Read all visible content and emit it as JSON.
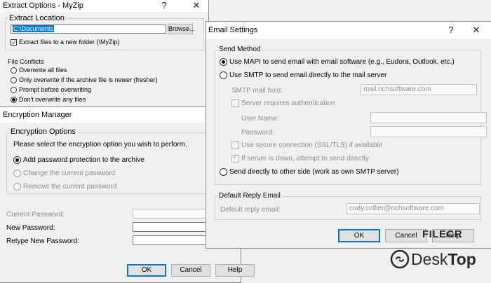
{
  "extract_window": {
    "title": "Extract Options - MyZip",
    "help_glyph": "?",
    "close_glyph": "✕",
    "extract_location": {
      "group_label": "Extract Location",
      "path_value": "C:\\Documents",
      "browse_label": "Browse...",
      "new_folder_label": "Extract files to a new folder (\\MyZip)",
      "new_folder_checked": true
    },
    "file_conflicts": {
      "group_label": "File Conflicts",
      "options": [
        "Overwrite all files",
        "Only overwrite if the archive file is newer (fresher)",
        "Prompt before overwriting",
        "Don't overwrite any files"
      ],
      "selected_index": 3
    }
  },
  "encryption_window": {
    "title": "Encryption Manager",
    "group_label": "Encryption Options",
    "instruction": "Please select the encryption option you wish to perform.",
    "options": [
      "Add password protection to the archive",
      "Change the current password",
      "Remove the current password"
    ],
    "selected_index": 0,
    "current_password_label": "Current Password:",
    "new_password_label": "New Password:",
    "retype_password_label": "Retype New Password:",
    "ok_label": "OK",
    "cancel_label": "Cancel",
    "help_label": "Help"
  },
  "email_window": {
    "title": "Email Settings",
    "help_glyph": "?",
    "close_glyph": "✕",
    "send_method": {
      "group_label": "Send Method",
      "mapi_label": "Use MAPI to send email with email software (e.g., Eudora, Outlook, etc.)",
      "smtp_label": "Use SMTP to send email directly to the mail server",
      "smtp_host_label": "SMTP mail host:",
      "smtp_host_value": "mail.nchsoftware.com",
      "auth_label": "Server requires authentication",
      "username_label": "User Name:",
      "password_label": "Password:",
      "ssl_label": "Use secure connection (SSL/TLS) if available",
      "fallback_label": "If server is down, attempt to send directly",
      "fallback_checked": true,
      "direct_label": "Send directly to other side (work as own SMTP server)",
      "selected": "mapi"
    },
    "reply": {
      "group_label": "Default Reply Email",
      "label": "Default reply email:",
      "value": "cody.collier@nchsoftware.com"
    },
    "ok_label": "OK",
    "cancel_label": "Cancel",
    "help_label": "Help"
  },
  "watermark": {
    "brand": "FILECR",
    "name_part1": "Desk",
    "name_part2": "Top"
  },
  "colors": {
    "accent": "#0078d7",
    "watermark": "#2a2a2a"
  }
}
